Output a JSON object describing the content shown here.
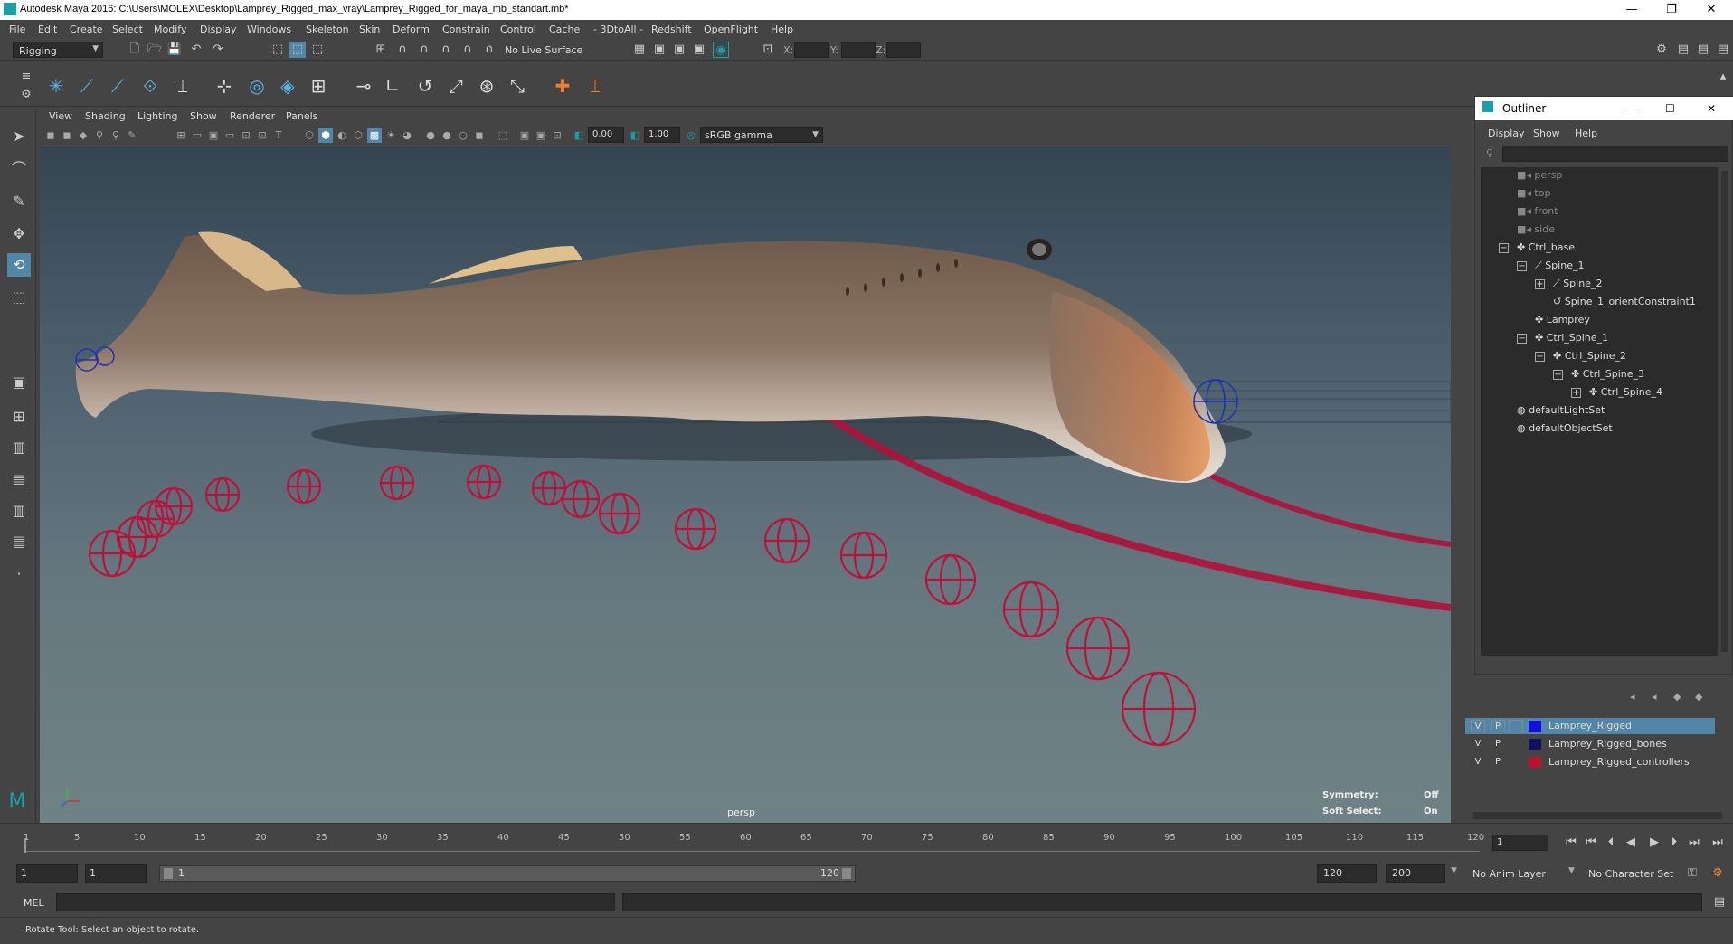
{
  "window": {
    "title": "Autodesk Maya 2016: C:\\Users\\MOLEX\\Desktop\\Lamprey_Rigged_max_vray\\Lamprey_Rigged_for_maya_mb_standart.mb*",
    "minimize": "—",
    "restore": "❐",
    "close": "✕"
  },
  "menubar": [
    "File",
    "Edit",
    "Create",
    "Select",
    "Modify",
    "Display",
    "Windows",
    "Skeleton",
    "Skin",
    "Deform",
    "Constrain",
    "Control",
    "Cache",
    "- 3DtoAll -",
    "Redshift",
    "OpenFlight",
    "Help"
  ],
  "shelf": {
    "mode": "Rigging",
    "live_surface": "No Live Surface",
    "x_label": "X:",
    "y_label": "Y:",
    "z_label": "Z:"
  },
  "viewport": {
    "menus": [
      "View",
      "Shading",
      "Lighting",
      "Show",
      "Renderer",
      "Panels"
    ],
    "exposure": "0.00",
    "gamma": "1.00",
    "color_space": "sRGB gamma",
    "camera_label": "persp",
    "symmetry_label": "Symmetry:",
    "symmetry_value": "Off",
    "soft_select_label": "Soft Select:",
    "soft_select_value": "On"
  },
  "outliner": {
    "title": "Outliner",
    "menus": [
      "Display",
      "Show",
      "Help"
    ],
    "items": [
      {
        "label": "persp",
        "dim": true
      },
      {
        "label": "top",
        "dim": true
      },
      {
        "label": "front",
        "dim": true
      },
      {
        "label": "side",
        "dim": true
      },
      {
        "label": "Ctrl_base",
        "dim": false
      },
      {
        "label": "Spine_1",
        "dim": false
      },
      {
        "label": "Spine_2",
        "dim": false
      },
      {
        "label": "Spine_1_orientConstraint1",
        "dim": false
      },
      {
        "label": "Lamprey",
        "dim": false
      },
      {
        "label": "Ctrl_Spine_1",
        "dim": false
      },
      {
        "label": "Ctrl_Spine_2",
        "dim": false
      },
      {
        "label": "Ctrl_Spine_3",
        "dim": false
      },
      {
        "label": "Ctrl_Spine_4",
        "dim": false
      },
      {
        "label": "defaultLightSet",
        "dim": false
      },
      {
        "label": "defaultObjectSet",
        "dim": false
      }
    ]
  },
  "layers": [
    {
      "v": "V",
      "p": "P",
      "name": "Lamprey_Rigged",
      "color": "#1010e0",
      "selected": true
    },
    {
      "v": "V",
      "p": "P",
      "name": "Lamprey_Rigged_bones",
      "color": "#101060",
      "selected": false
    },
    {
      "v": "V",
      "p": "P",
      "name": "Lamprey_Rigged_controllers",
      "color": "#c01030",
      "selected": false
    }
  ],
  "timeline": {
    "ticks": [
      "5",
      "10",
      "15",
      "20",
      "25",
      "30",
      "35",
      "40",
      "45",
      "50",
      "55",
      "60",
      "65",
      "70",
      "75",
      "80",
      "85",
      "90",
      "95",
      "100",
      "105",
      "110",
      "115",
      "120"
    ],
    "start_tick": "1",
    "current_frame": "1"
  },
  "range": {
    "start": "1",
    "playback_start": "1",
    "slider_start": "1",
    "slider_end": "120",
    "playback_end": "120",
    "end": "200",
    "anim_layer": "No Anim Layer",
    "character_set": "No Character Set"
  },
  "command": {
    "language": "MEL"
  },
  "status": {
    "help_text": "Rotate Tool: Select an object to rotate."
  }
}
